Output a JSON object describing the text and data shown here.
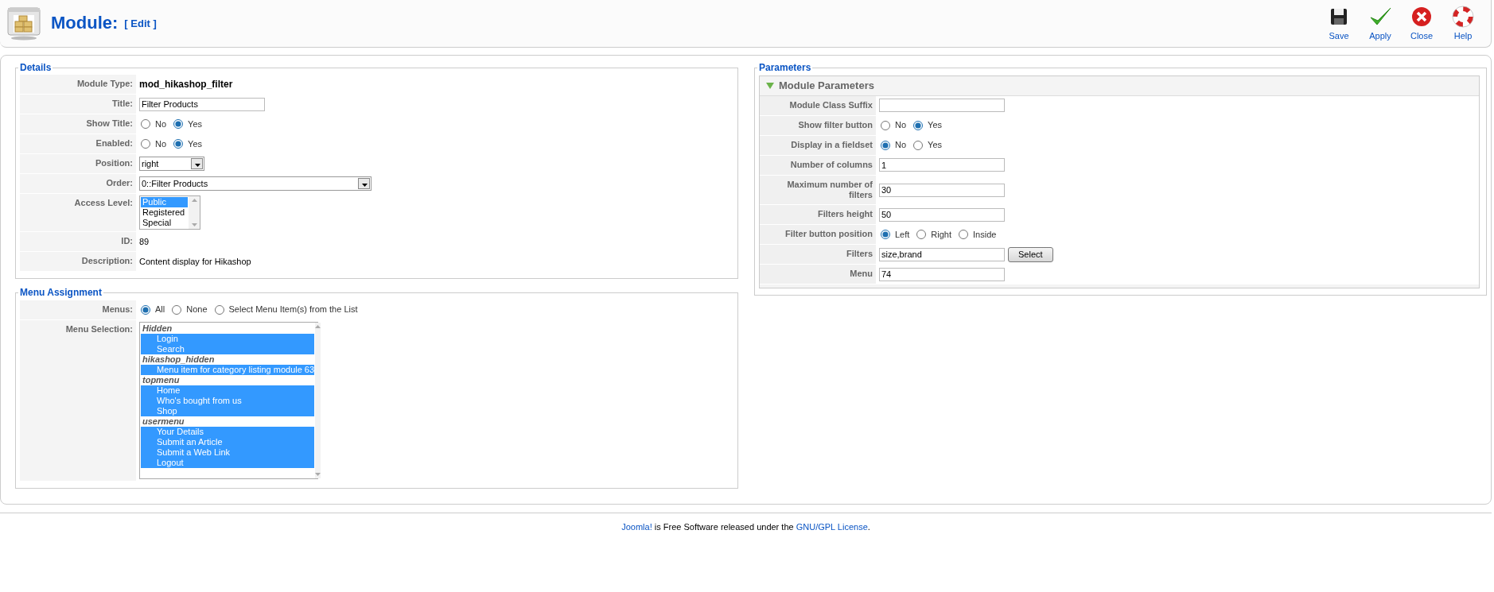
{
  "header": {
    "title": "Module:",
    "subtitle": "[ Edit ]"
  },
  "toolbar": [
    {
      "kind": "save",
      "label": "Save"
    },
    {
      "kind": "apply",
      "label": "Apply"
    },
    {
      "kind": "close",
      "label": "Close"
    },
    {
      "kind": "help",
      "label": "Help"
    }
  ],
  "details": {
    "legend": "Details",
    "rows": [
      {
        "kind": "bold_text",
        "label": "Module Type:",
        "value": "mod_hikashop_filter"
      },
      {
        "kind": "input",
        "label": "Title:",
        "value": "Filter Products"
      },
      {
        "kind": "radio",
        "label": "Show Title:",
        "options": [
          {
            "label": "No",
            "selected": false
          },
          {
            "label": "Yes",
            "selected": true
          }
        ]
      },
      {
        "kind": "radio",
        "label": "Enabled:",
        "options": [
          {
            "label": "No",
            "selected": false
          },
          {
            "label": "Yes",
            "selected": true
          }
        ]
      },
      {
        "kind": "short_select",
        "label": "Position:",
        "value": "right"
      },
      {
        "kind": "long_select",
        "label": "Order:",
        "value": "0::Filter Products"
      },
      {
        "kind": "listbox",
        "label": "Access Level:",
        "options": [
          {
            "label": "Public",
            "selected": true
          },
          {
            "label": "Registered",
            "selected": false
          },
          {
            "label": "Special",
            "selected": false
          }
        ]
      },
      {
        "kind": "text",
        "label": "ID:",
        "value": "89"
      },
      {
        "kind": "text",
        "label": "Description:",
        "value": "Content display for Hikashop"
      }
    ]
  },
  "menu_assignment": {
    "legend": "Menu Assignment",
    "rows": [
      {
        "kind": "radio",
        "label": "Menus:",
        "options": [
          {
            "label": "All",
            "selected": true
          },
          {
            "label": "None",
            "selected": false
          },
          {
            "label": "Select Menu Item(s) from the List",
            "selected": false
          }
        ]
      },
      {
        "kind": "menu_list",
        "label": "Menu Selection:",
        "groups": [
          {
            "name": "Hidden",
            "items": [
              {
                "label": "Login",
                "selected": true
              },
              {
                "label": "Search",
                "selected": true
              }
            ]
          },
          {
            "name": "hikashop_hidden",
            "items": [
              {
                "label": "Menu item for category listing module 63",
                "selected": true
              }
            ]
          },
          {
            "name": "topmenu",
            "items": [
              {
                "label": "Home",
                "selected": true
              },
              {
                "label": "Who's bought from us",
                "selected": true
              },
              {
                "label": "Shop",
                "selected": true
              }
            ]
          },
          {
            "name": "usermenu",
            "items": [
              {
                "label": "Your Details",
                "selected": true
              },
              {
                "label": "Submit an Article",
                "selected": true
              },
              {
                "label": "Submit a Web Link",
                "selected": true
              },
              {
                "label": "Logout",
                "selected": true
              }
            ]
          }
        ]
      }
    ]
  },
  "parameters": {
    "legend": "Parameters",
    "section": {
      "title": "Module Parameters",
      "expanded": true
    },
    "rows": [
      {
        "kind": "input",
        "label": "Module Class Suffix",
        "value": ""
      },
      {
        "kind": "radio",
        "label": "Show filter button",
        "options": [
          {
            "label": "No",
            "selected": false
          },
          {
            "label": "Yes",
            "selected": true
          }
        ]
      },
      {
        "kind": "radio",
        "label": "Display in a fieldset",
        "options": [
          {
            "label": "No",
            "selected": true
          },
          {
            "label": "Yes",
            "selected": false
          }
        ]
      },
      {
        "kind": "input",
        "label": "Number of columns",
        "value": "1"
      },
      {
        "kind": "input",
        "label": "Maximum number of filters",
        "value": "30"
      },
      {
        "kind": "input",
        "label": "Filters height",
        "value": "50"
      },
      {
        "kind": "radio",
        "label": "Filter button position",
        "options": [
          {
            "label": "Left",
            "selected": true
          },
          {
            "label": "Right",
            "selected": false
          },
          {
            "label": "Inside",
            "selected": false
          }
        ]
      },
      {
        "kind": "input_button",
        "label": "Filters",
        "value": "size,brand",
        "button": "Select"
      },
      {
        "kind": "input",
        "label": "Menu",
        "value": "74"
      }
    ]
  },
  "footer": {
    "parts": [
      {
        "text": "Joomla!",
        "link": true
      },
      {
        "text": " is Free Software released under the ",
        "link": false
      },
      {
        "text": "GNU/GPL License",
        "link": true
      },
      {
        "text": ".",
        "link": false
      }
    ]
  }
}
